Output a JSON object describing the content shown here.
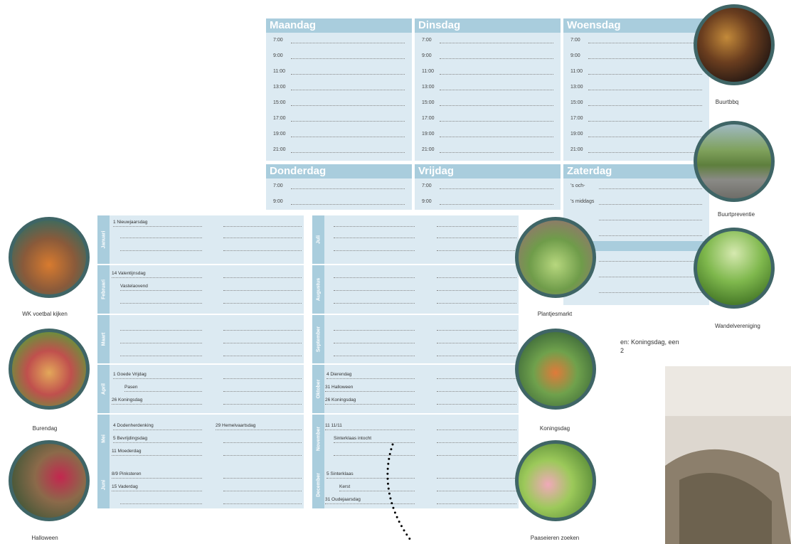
{
  "week": {
    "days_top": [
      "Maandag",
      "Dinsdag",
      "Woensdag"
    ],
    "days_bottom": [
      "Donderdag",
      "Vrijdag",
      "Zaterdag"
    ],
    "times": [
      "7:00",
      "9:00",
      "11:00",
      "13:00",
      "15:00",
      "17:00",
      "19:00",
      "21:00"
    ],
    "saturday_slots": [
      "’s och-",
      "’s middags"
    ]
  },
  "year": {
    "months_left": [
      "Januari",
      "Februari",
      "Maart",
      "April",
      "Mei",
      "Juni"
    ],
    "months_right": [
      "Juli",
      "Augustus",
      "September",
      "Oktober",
      "November",
      "December"
    ],
    "entries": {
      "jan": [
        "1 Nieuwjaarsdag"
      ],
      "feb": [
        "14 Valentijnsdag",
        "Vastelaovend"
      ],
      "apr": [
        "1 Goede Vrijdag",
        "Pasen",
        "26 Koningsdag"
      ],
      "mei": [
        "4 Dodenherdenking",
        "5 Bevrijdingsdag",
        "11 Moederdag"
      ],
      "mei_right": "29 Hemelvaartsdag",
      "jun": [
        "8/9 Pinksteren",
        "15 Vaderdag"
      ],
      "okt": [
        "4 Dierendag",
        "31 Halloween",
        "26 Koningsdag"
      ],
      "nov": [
        "11 11/11",
        "Sinterklaas intocht"
      ],
      "dec": [
        "5 Sinterklaas",
        "Kerst",
        "31 Oudejaarsdag"
      ]
    }
  },
  "captions": {
    "buurtbbq": "Buurtbbq",
    "buurtpreventie": "Buurtpreventie",
    "wandelvereniging": "Wandelvereniging",
    "wk": "WK voetbal kijken",
    "burendag": "Burendag",
    "halloween": "Halloween",
    "plantjesmarkt": "Plantjesmarkt",
    "koningsdag": "Koningsdag",
    "paaseieren": "Paaseieren zoeken"
  },
  "snippet": "en: Koningsdag, een",
  "colors": {
    "header": "#a9cddd",
    "panel": "#dceaf2",
    "ring": "#3f6566"
  }
}
